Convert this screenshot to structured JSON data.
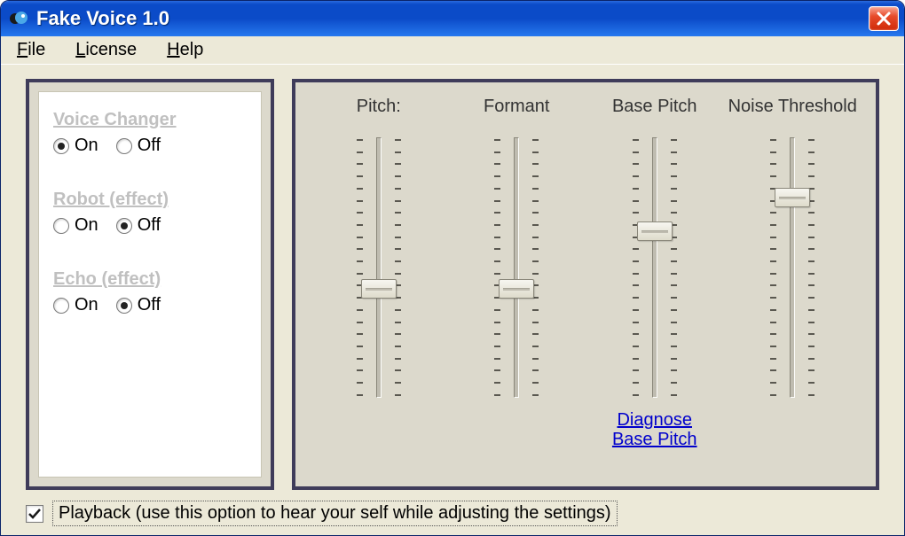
{
  "window": {
    "title": "Fake Voice 1.0"
  },
  "menu": {
    "file": "File",
    "license": "License",
    "help": "Help"
  },
  "effects": {
    "voice_changer": {
      "label": "Voice Changer",
      "on": "On",
      "off": "Off",
      "value": "on"
    },
    "robot": {
      "label": "Robot (effect)",
      "on": "On",
      "off": "Off",
      "value": "off"
    },
    "echo": {
      "label": "Echo (effect)",
      "on": "On",
      "off": "Off",
      "value": "off"
    }
  },
  "sliders": {
    "pitch": {
      "label": "Pitch:",
      "value": 42
    },
    "formant": {
      "label": "Formant",
      "value": 42
    },
    "base": {
      "label": "Base Pitch",
      "value": 64,
      "diagnose": "Diagnose\nBase Pitch"
    },
    "noise": {
      "label": "Noise Threshold",
      "value": 77
    }
  },
  "playback": {
    "checked": true,
    "label": "Playback (use this option to hear your self while adjusting the settings)"
  }
}
